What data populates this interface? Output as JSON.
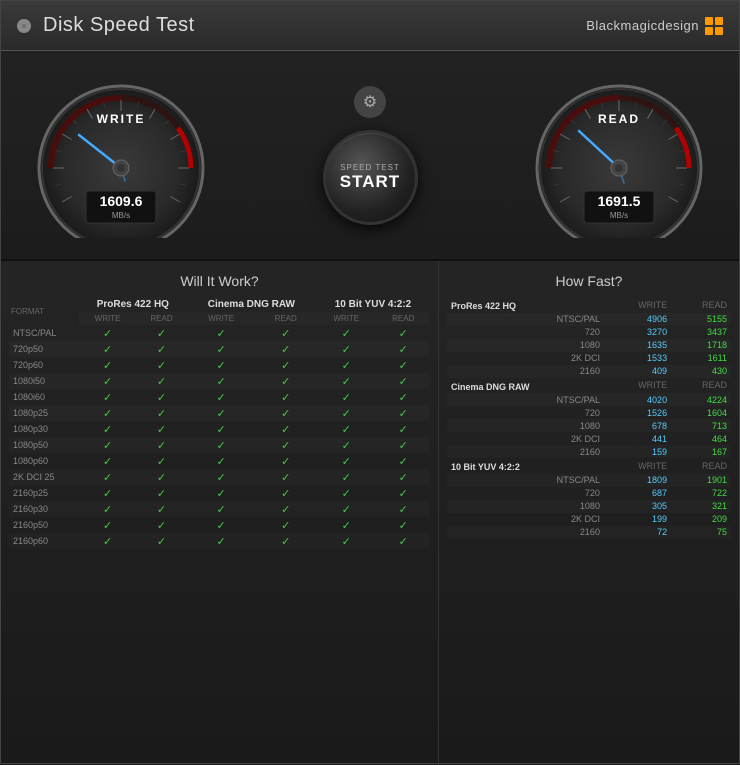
{
  "app": {
    "title": "Disk Speed Test",
    "brand": "Blackmagicdesign",
    "close_label": "×"
  },
  "gauges": {
    "write": {
      "label": "WRITE",
      "value": "1609.6",
      "unit": "MB/s",
      "needle_angle": -35
    },
    "read": {
      "label": "READ",
      "value": "1691.5",
      "unit": "MB/s",
      "needle_angle": -30
    }
  },
  "controls": {
    "gear_icon": "⚙",
    "speed_test_label": "SPEED TEST",
    "start_label": "START"
  },
  "will_it_work": {
    "title": "Will It Work?",
    "categories": [
      "ProRes 422 HQ",
      "Cinema DNG RAW",
      "10 Bit YUV 4:2:2"
    ],
    "format_col": "FORMAT",
    "write_col": "WRITE",
    "read_col": "READ",
    "rows": [
      {
        "format": "NTSC/PAL"
      },
      {
        "format": "720p50"
      },
      {
        "format": "720p60"
      },
      {
        "format": "1080i50"
      },
      {
        "format": "1080i60"
      },
      {
        "format": "1080p25"
      },
      {
        "format": "1080p30"
      },
      {
        "format": "1080p50"
      },
      {
        "format": "1080p60"
      },
      {
        "format": "2K DCI 25"
      },
      {
        "format": "2160p25"
      },
      {
        "format": "2160p30"
      },
      {
        "format": "2160p50"
      },
      {
        "format": "2160p60"
      }
    ]
  },
  "how_fast": {
    "title": "How Fast?",
    "sections": [
      {
        "category": "ProRes 422 HQ",
        "write_header": "WRITE",
        "read_header": "READ",
        "rows": [
          {
            "label": "NTSC/PAL",
            "write": "4906",
            "read": "5155"
          },
          {
            "label": "720",
            "write": "3270",
            "read": "3437"
          },
          {
            "label": "1080",
            "write": "1635",
            "read": "1718"
          },
          {
            "label": "2K DCI",
            "write": "1533",
            "read": "1611"
          },
          {
            "label": "2160",
            "write": "409",
            "read": "430"
          }
        ]
      },
      {
        "category": "Cinema DNG RAW",
        "write_header": "WRITE",
        "read_header": "READ",
        "rows": [
          {
            "label": "NTSC/PAL",
            "write": "4020",
            "read": "4224"
          },
          {
            "label": "720",
            "write": "1526",
            "read": "1604"
          },
          {
            "label": "1080",
            "write": "678",
            "read": "713"
          },
          {
            "label": "2K DCI",
            "write": "441",
            "read": "464"
          },
          {
            "label": "2160",
            "write": "159",
            "read": "167"
          }
        ]
      },
      {
        "category": "10 Bit YUV 4:2:2",
        "write_header": "WRITE",
        "read_header": "READ",
        "rows": [
          {
            "label": "NTSC/PAL",
            "write": "1809",
            "read": "1901"
          },
          {
            "label": "720",
            "write": "687",
            "read": "722"
          },
          {
            "label": "1080",
            "write": "305",
            "read": "321"
          },
          {
            "label": "2K DCI",
            "write": "199",
            "read": "209"
          },
          {
            "label": "2160",
            "write": "72",
            "read": "75"
          }
        ]
      }
    ]
  }
}
